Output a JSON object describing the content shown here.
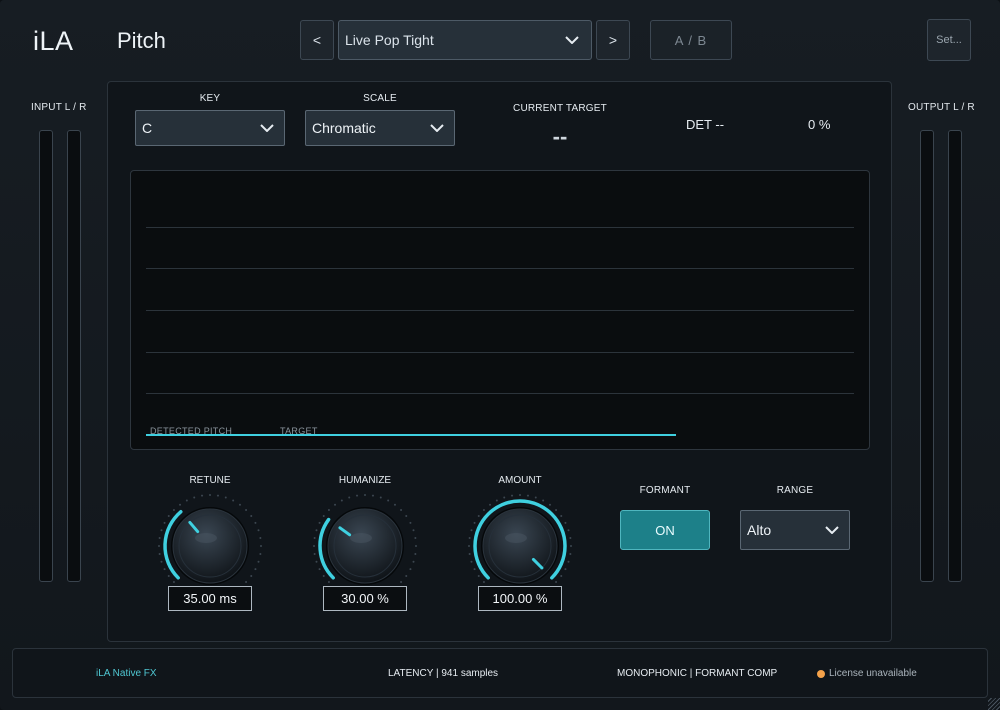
{
  "header": {
    "logo": "iLA",
    "plugin_name": "Pitch",
    "prev_label": "<",
    "next_label": ">",
    "preset": "Live Pop Tight",
    "ab_label": "A / B",
    "settings_label": "Set..."
  },
  "meters": {
    "input_label": "INPUT  L / R",
    "output_label": "OUTPUT  L / R"
  },
  "controls": {
    "key_label": "KEY",
    "key_value": "C",
    "scale_label": "SCALE",
    "scale_value": "Chromatic",
    "current_target_label": "CURRENT TARGET",
    "current_target_value": "--",
    "det_text": "DET  --",
    "det_percent": "0 %"
  },
  "graph": {
    "detected_label": "DETECTED PITCH",
    "target_label": "TARGET"
  },
  "knobs": {
    "retune": {
      "label": "RETUNE",
      "value_text": "35.00 ms",
      "level": 0.35
    },
    "humanize": {
      "label": "HUMANIZE",
      "value_text": "30.00 %",
      "level": 0.3
    },
    "amount": {
      "label": "AMOUNT",
      "value_text": "100.00 %",
      "level": 1.0
    }
  },
  "formant": {
    "label": "FORMANT",
    "button": "ON"
  },
  "range": {
    "label": "RANGE",
    "value": "Alto"
  },
  "footer": {
    "brand": "iLA  Native FX",
    "latency": "LATENCY  |  941 samples",
    "mode": "MONOPHONIC  |  FORMANT COMP",
    "license": "License unavailable"
  },
  "colors": {
    "accent": "#3fd0e0",
    "button_on": "#1d8089",
    "license_dot": "#f5a24a"
  }
}
